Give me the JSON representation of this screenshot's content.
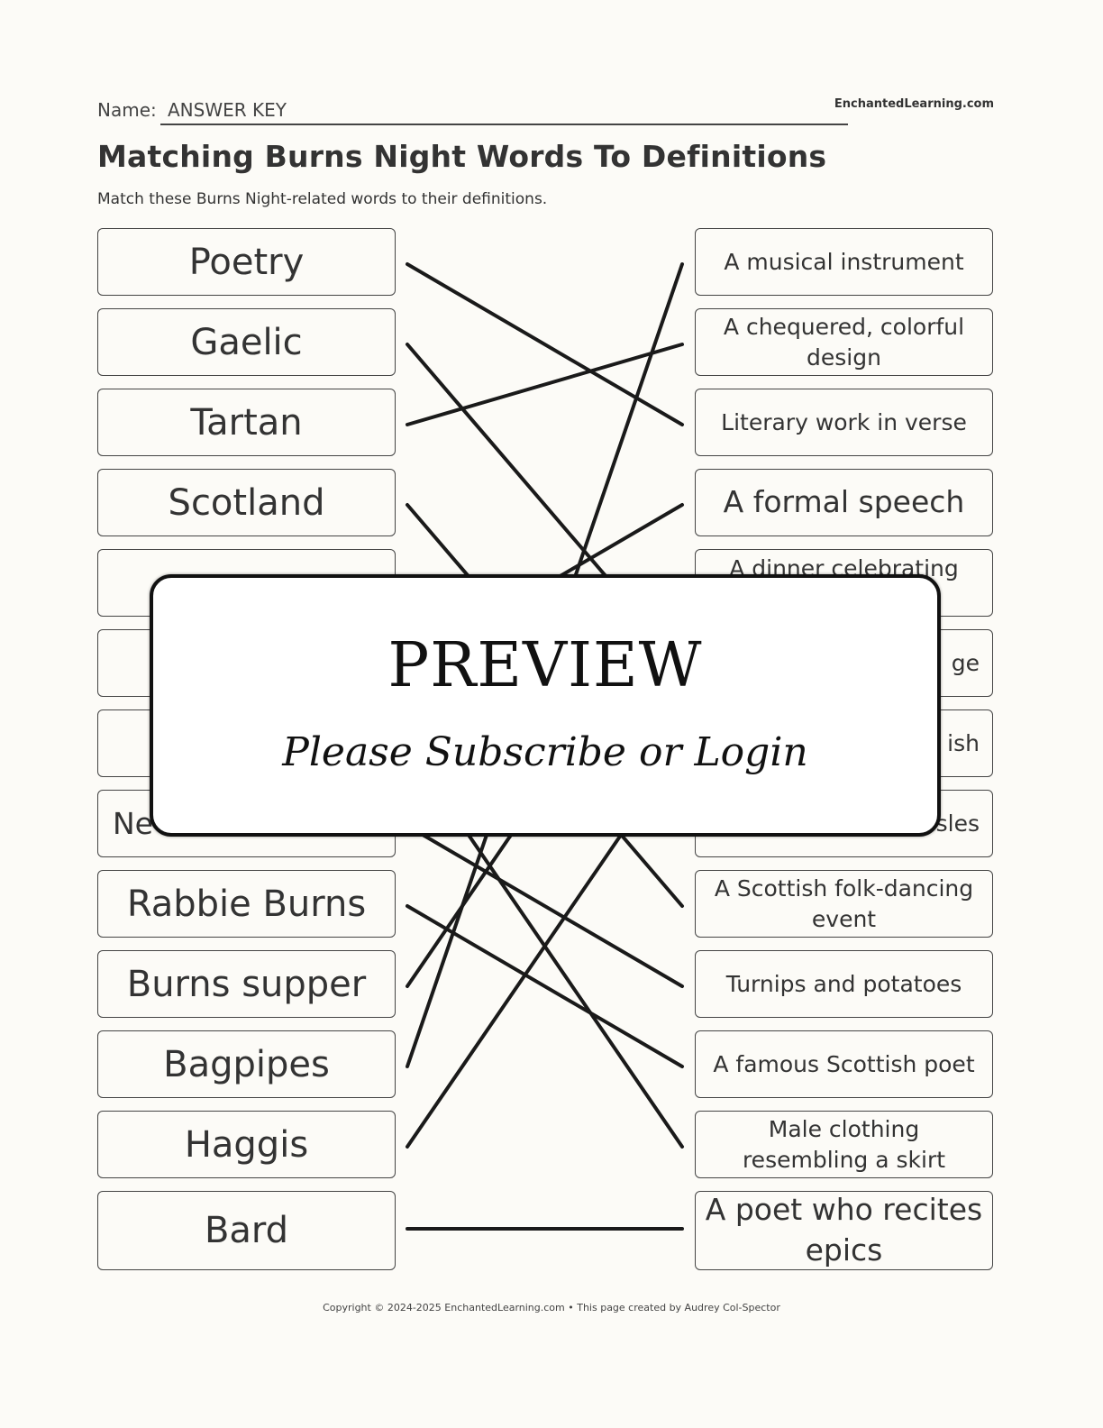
{
  "header": {
    "name_label": "Name:",
    "name_value": "ANSWER KEY",
    "brand": "EnchantedLearning.com"
  },
  "title": "Matching Burns Night Words To Definitions",
  "instructions": "Match these Burns Night-related words to their definitions.",
  "words": [
    {
      "text": "Poetry"
    },
    {
      "text": "Gaelic"
    },
    {
      "text": "Tartan"
    },
    {
      "text": "Scotland"
    },
    {
      "text": ""
    },
    {
      "text": ""
    },
    {
      "text": ""
    },
    {
      "text": "Ne"
    },
    {
      "text": "Rabbie Burns"
    },
    {
      "text": "Burns supper"
    },
    {
      "text": "Bagpipes"
    },
    {
      "text": "Haggis"
    },
    {
      "text": "Bard"
    }
  ],
  "definitions": [
    {
      "text": "A musical instrument"
    },
    {
      "text": "A chequered, colorful design"
    },
    {
      "text": "Literary work in verse"
    },
    {
      "text": "A formal speech"
    },
    {
      "text": "A dinner celebrating"
    },
    {
      "text": "ge"
    },
    {
      "text": "ish"
    },
    {
      "text": "sles"
    },
    {
      "text": "A Scottish folk-dancing event"
    },
    {
      "text": "Turnips and potatoes"
    },
    {
      "text": "A famous Scottish poet"
    },
    {
      "text": "Male clothing resembling a skirt"
    },
    {
      "text": "A poet who recites epics"
    }
  ],
  "matches": [
    {
      "word": 0,
      "definition": 2
    },
    {
      "word": 1,
      "definition": 5
    },
    {
      "word": 2,
      "definition": 1
    },
    {
      "word": 3,
      "definition": 7
    },
    {
      "word": 4,
      "definition": 8
    },
    {
      "word": 5,
      "definition": 3
    },
    {
      "word": 6,
      "definition": 11
    },
    {
      "word": 7,
      "definition": 9
    },
    {
      "word": 8,
      "definition": 10
    },
    {
      "word": 9,
      "definition": 4
    },
    {
      "word": 10,
      "definition": 0
    },
    {
      "word": 11,
      "definition": 6
    },
    {
      "word": 12,
      "definition": 12
    }
  ],
  "overlay": {
    "title": "PREVIEW",
    "subtitle": "Please Subscribe or Login"
  },
  "footer": "Copyright © 2024-2025 EnchantedLearning.com • This page created by Audrey Col-Spector",
  "colors": {
    "background": "#fcfbf7",
    "text": "#333333",
    "line": "#1a1a1a"
  }
}
